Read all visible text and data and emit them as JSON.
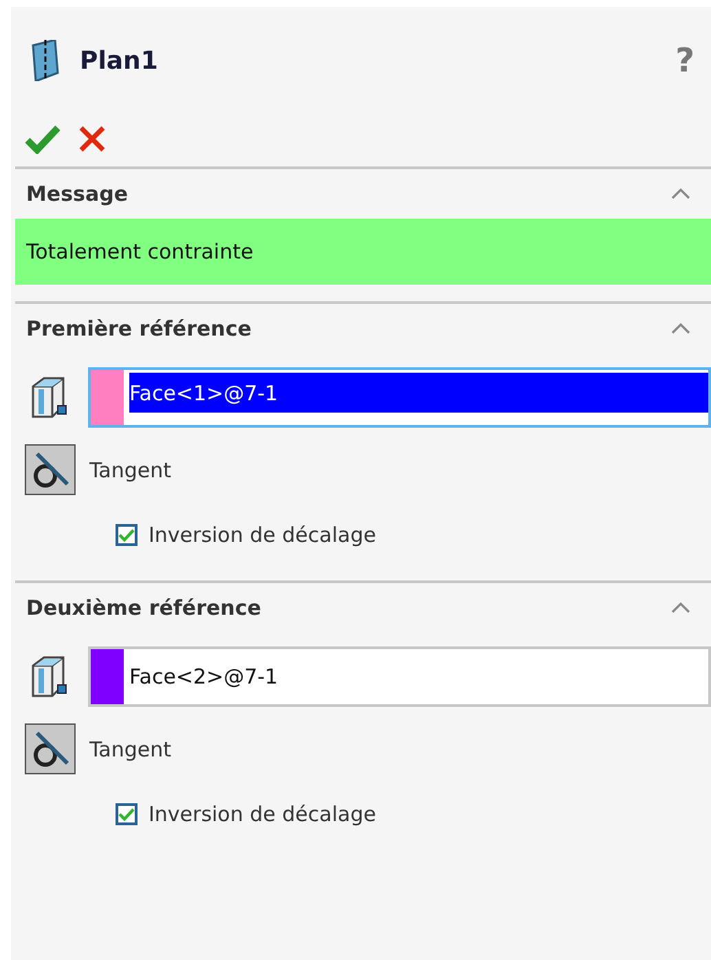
{
  "title": "Plan1",
  "help": "?",
  "message": {
    "header": "Message",
    "expanded": true,
    "text": "Totalement contrainte"
  },
  "references": [
    {
      "header": "Première référence",
      "expanded": true,
      "color": "#ff7fc0",
      "value": "Face<1>@7-1",
      "selected": true,
      "constraint": "Tangent",
      "pressed": true,
      "flip": {
        "label": "Inversion de décalage",
        "checked": true
      }
    },
    {
      "header": "Deuxième référence",
      "expanded": true,
      "color": "#8000ff",
      "value": "Face<2>@7-1",
      "selected": false,
      "constraint": "Tangent",
      "pressed": true,
      "flip": {
        "label": "Inversion de décalage",
        "checked": true
      }
    }
  ]
}
